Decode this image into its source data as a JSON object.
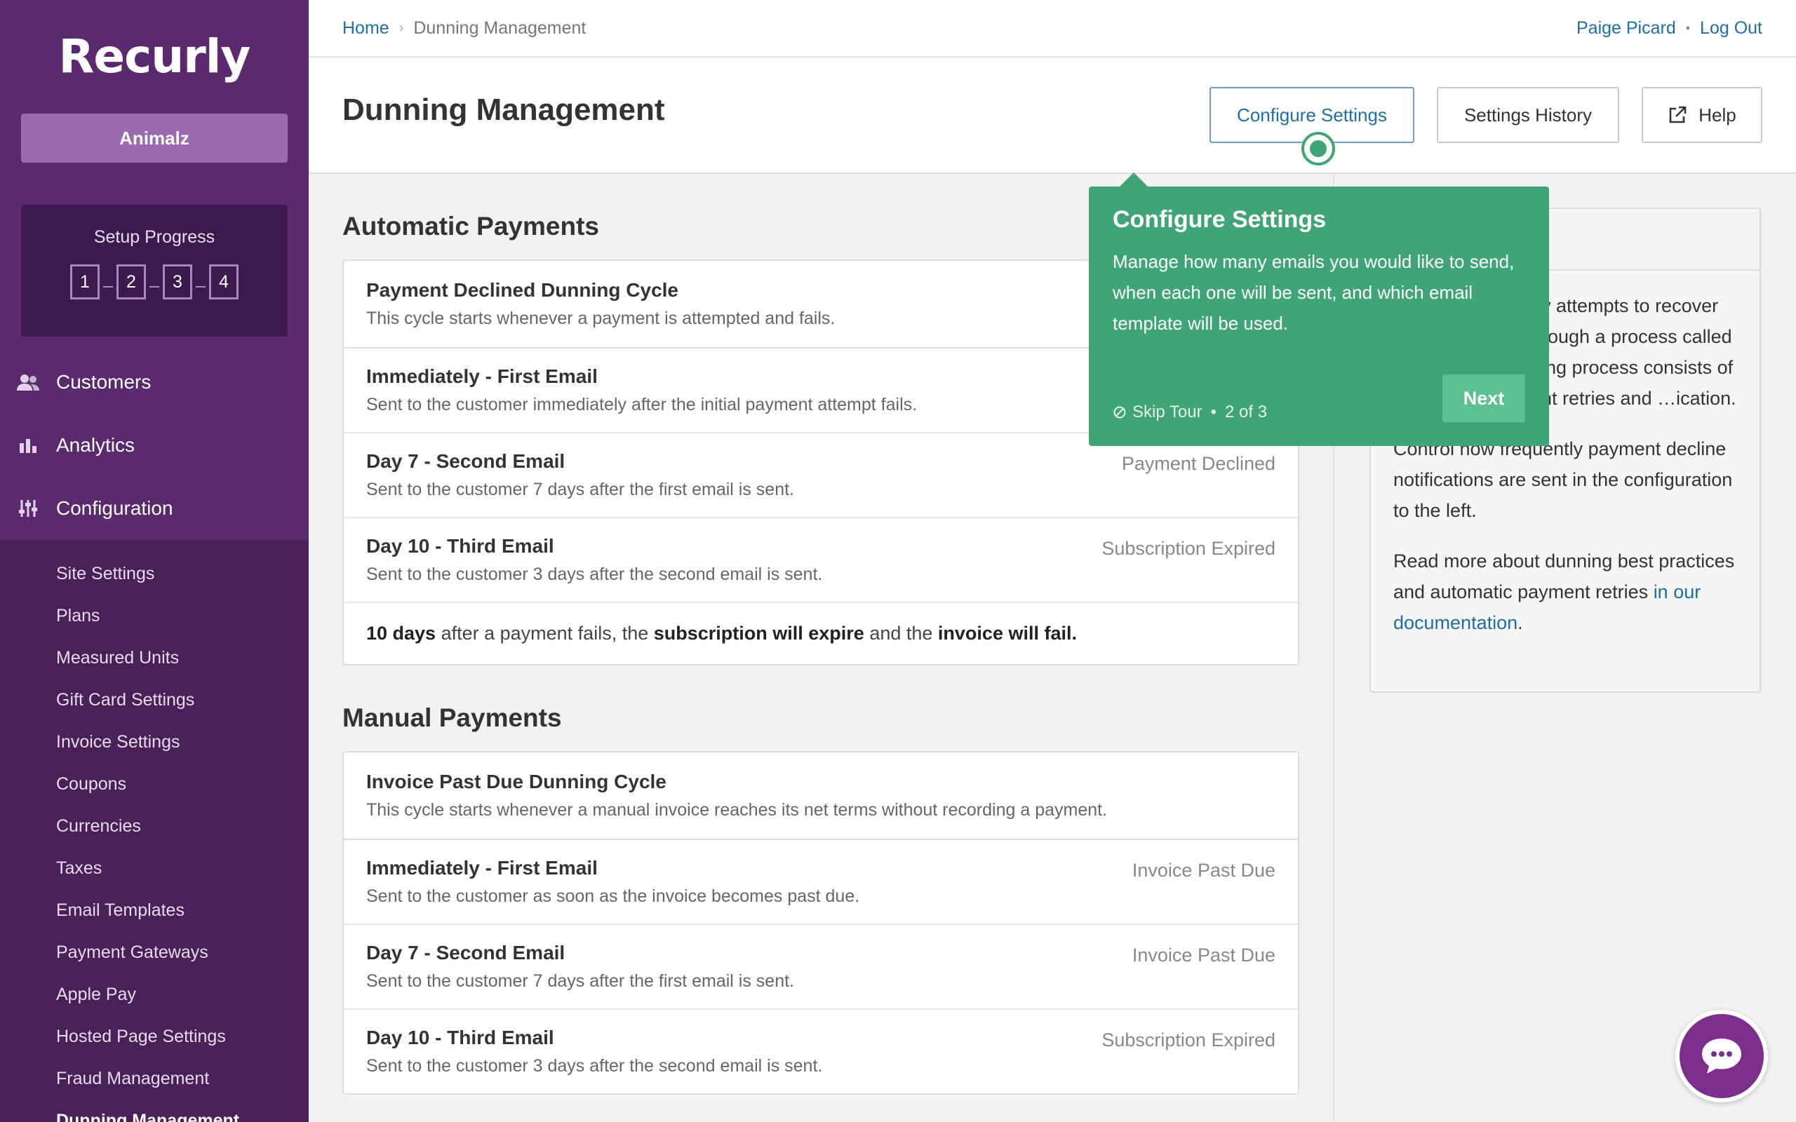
{
  "brand": {
    "logo": "Recurly",
    "site_name": "Animalz"
  },
  "setup": {
    "title": "Setup Progress",
    "steps": [
      "1",
      "2",
      "3",
      "4"
    ]
  },
  "nav": {
    "customers": "Customers",
    "analytics": "Analytics",
    "configuration": "Configuration"
  },
  "subnav": [
    "Site Settings",
    "Plans",
    "Measured Units",
    "Gift Card Settings",
    "Invoice Settings",
    "Coupons",
    "Currencies",
    "Taxes",
    "Email Templates",
    "Payment Gateways",
    "Apple Pay",
    "Hosted Page Settings",
    "Fraud Management",
    "Dunning Management"
  ],
  "breadcrumb": {
    "home": "Home",
    "current": "Dunning Management"
  },
  "user": {
    "name": "Paige Picard",
    "logout": "Log Out"
  },
  "page": {
    "title": "Dunning Management",
    "buttons": {
      "configure": "Configure Settings",
      "history": "Settings History",
      "help": "Help"
    }
  },
  "automatic": {
    "title": "Automatic Payments",
    "cycle_title": "Payment Declined Dunning Cycle",
    "cycle_sub": "This cycle starts whenever a payment is attempted and fails.",
    "rows": [
      {
        "title": "Immediately - First Email",
        "sub": "Sent to the customer immediately after the initial payment attempt fails.",
        "right": ""
      },
      {
        "title": "Day 7 - Second Email",
        "sub": "Sent to the customer 7 days after the first email is sent.",
        "right": "Payment Declined"
      },
      {
        "title": "Day 10 - Third Email",
        "sub": "Sent to the customer 3 days after the second email is sent.",
        "right": "Subscription Expired"
      }
    ],
    "summary": {
      "p1": "10 days",
      "p2": " after a payment fails, the ",
      "p3": "subscription will expire",
      "p4": " and the ",
      "p5": "invoice will fail."
    }
  },
  "manual": {
    "title": "Manual Payments",
    "cycle_title": "Invoice Past Due Dunning Cycle",
    "cycle_sub": "This cycle starts whenever a manual invoice reaches its net terms without recording a payment.",
    "rows": [
      {
        "title": "Immediately - First Email",
        "sub": "Sent to the customer as soon as the invoice becomes past due.",
        "right": "Invoice Past Due"
      },
      {
        "title": "Day 7 - Second Email",
        "sub": "Sent to the customer 7 days after the first email is sent.",
        "right": "Invoice Past Due"
      },
      {
        "title": "Day 10 - Third Email",
        "sub": "Sent to the customer 3 days after the second email is sent.",
        "right": "Subscription Expired"
      }
    ]
  },
  "info": {
    "p1": "…y attempts to recover …rough a process called …ing process consists of …nt retries and …ication.",
    "p2": "Control how frequently payment decline notifications are sent in the configuration to the left.",
    "p3a": "Read more about dunning best practices and automatic payment retries ",
    "p3link": "in our documentation",
    "p3b": "."
  },
  "tour": {
    "title": "Configure Settings",
    "text": "Manage how many emails you would like to send, when each one will be sent, and which email template will be used.",
    "skip": "Skip Tour",
    "progress": "2 of 3",
    "next": "Next"
  },
  "colors": {
    "sidebar": "#5b2a6e",
    "accent": "#3fa578",
    "link": "#1f6ea6"
  },
  "icons": [
    "customers-icon",
    "analytics-icon",
    "configuration-icon",
    "external-link-icon",
    "skip-icon",
    "chat-icon"
  ]
}
